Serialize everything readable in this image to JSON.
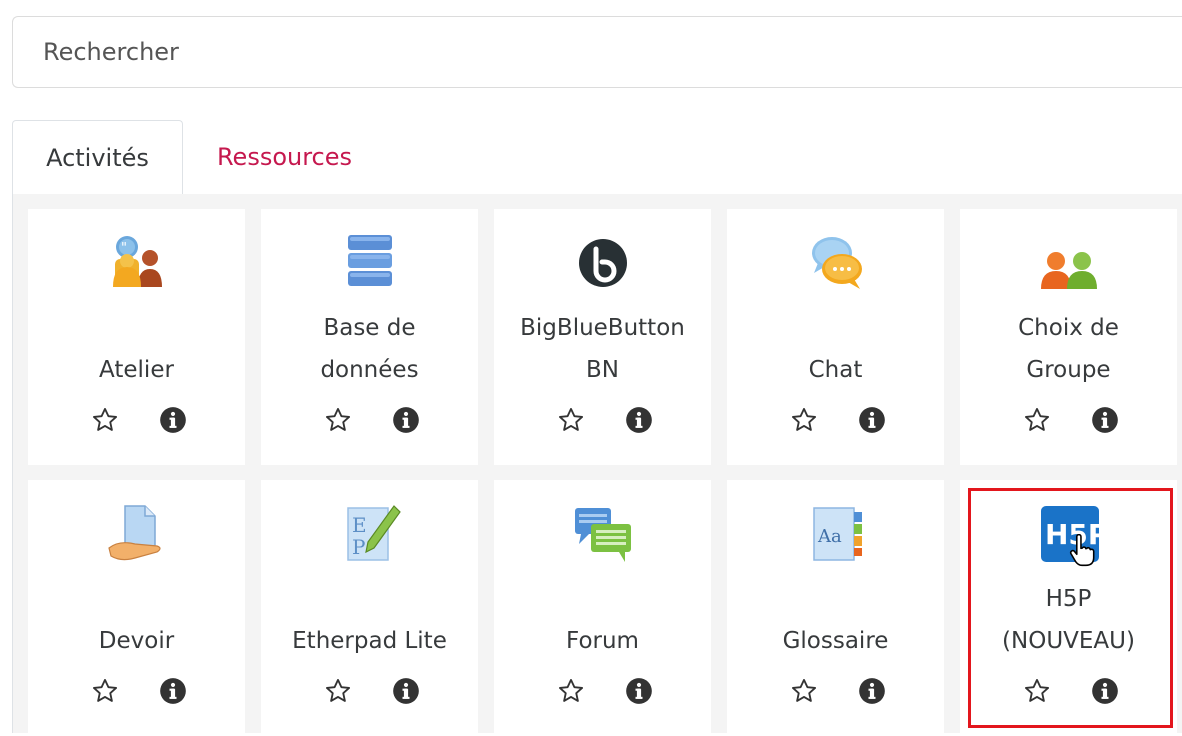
{
  "search": {
    "placeholder": "Rechercher"
  },
  "tabs": [
    {
      "label": "Activités",
      "active": true
    },
    {
      "label": "Ressources",
      "active": false
    }
  ],
  "colors": {
    "inactive_tab": "#c5184e",
    "highlight": "#e3161d",
    "panel_bg": "#f4f4f4"
  },
  "activities": [
    {
      "name": "Atelier",
      "lines": [
        "Atelier"
      ],
      "icon": "workshop-icon"
    },
    {
      "name": "Base de données",
      "lines": [
        "Base de",
        "données"
      ],
      "icon": "database-icon"
    },
    {
      "name": "BigBlueButton BN",
      "lines": [
        "BigBlueButton",
        "BN"
      ],
      "icon": "bigbluebutton-icon"
    },
    {
      "name": "Chat",
      "lines": [
        "Chat"
      ],
      "icon": "chat-icon"
    },
    {
      "name": "Choix de Groupe",
      "lines": [
        "Choix de",
        "Groupe"
      ],
      "icon": "group-choice-icon"
    },
    {
      "name": "Devoir",
      "lines": [
        "Devoir"
      ],
      "icon": "assignment-icon"
    },
    {
      "name": "Etherpad Lite",
      "lines": [
        "Etherpad Lite"
      ],
      "icon": "etherpad-icon"
    },
    {
      "name": "Forum",
      "lines": [
        "Forum"
      ],
      "icon": "forum-icon"
    },
    {
      "name": "Glossaire",
      "lines": [
        "Glossaire"
      ],
      "icon": "glossary-icon"
    },
    {
      "name": "H5P (NOUVEAU)",
      "lines": [
        "H5P",
        "(NOUVEAU)"
      ],
      "icon": "h5p-icon",
      "highlighted": true
    }
  ]
}
